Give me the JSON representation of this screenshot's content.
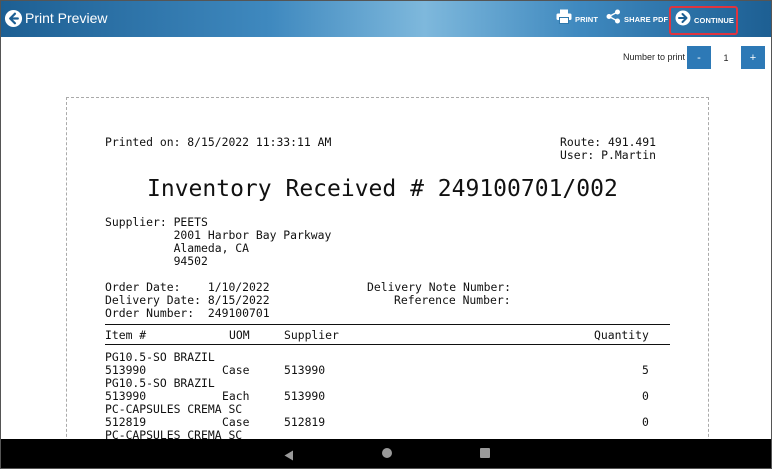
{
  "header": {
    "title": "Print Preview",
    "print_label": "PRINT",
    "share_label": "SHARE PDF",
    "continue_label": "CONTINUE",
    "icons": [
      "back-arrow-icon",
      "printer-icon",
      "share-icon",
      "arrow-right-circle-icon"
    ],
    "highlight_color": "#e0343f"
  },
  "print_controls": {
    "label": "Number to print",
    "minus": "-",
    "value": "1",
    "plus": "+"
  },
  "document": {
    "printed_on": "Printed on: 8/15/2022 11:33:11 AM",
    "route": "Route: 491.491",
    "user": "User: P.Martin",
    "title": "Inventory Received # 249100701/002",
    "supplier_lines": [
      "Supplier: PEETS",
      "          2001 Harbor Bay Parkway",
      "          Alameda, CA",
      "          94502"
    ],
    "order_date": "Order Date:    1/10/2022",
    "delivery_date": "Delivery Date: 8/15/2022",
    "order_number": "Order Number:  249100701",
    "delivery_note_number": "Delivery Note Number:",
    "reference_number": "Reference Number:",
    "columns": {
      "item": "Item #",
      "uom": "UOM",
      "supplier": "Supplier",
      "quantity": "Quantity"
    },
    "items": [
      {
        "name": "PG10.5-SO BRAZIL",
        "item": "513990",
        "uom": "Case",
        "supplier": "513990",
        "quantity": "5"
      },
      {
        "name": "PG10.5-SO BRAZIL",
        "item": "513990",
        "uom": "Each",
        "supplier": "513990",
        "quantity": "0"
      },
      {
        "name": "PC-CAPSULES CREMA SC",
        "item": "512819",
        "uom": "Case",
        "supplier": "512819",
        "quantity": "0"
      },
      {
        "name": "PC-CAPSULES CREMA SC"
      }
    ]
  },
  "navbar": {
    "icons": [
      "nav-back-icon",
      "nav-home-icon",
      "nav-recents-icon"
    ]
  }
}
